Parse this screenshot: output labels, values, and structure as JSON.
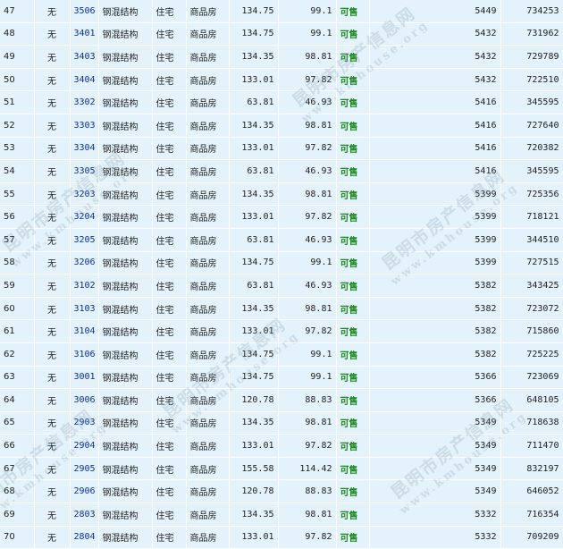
{
  "rows": [
    {
      "seq": "47",
      "wu": "无",
      "room": "3506",
      "structure": "钢混结构",
      "use": "住宅",
      "type": "商品房",
      "area": "134.75",
      "inner": "99.1",
      "status": "可售",
      "price": "5449",
      "total": "734253"
    },
    {
      "seq": "48",
      "wu": "无",
      "room": "3401",
      "structure": "钢混结构",
      "use": "住宅",
      "type": "商品房",
      "area": "134.75",
      "inner": "99.1",
      "status": "可售",
      "price": "5432",
      "total": "731962"
    },
    {
      "seq": "49",
      "wu": "无",
      "room": "3403",
      "structure": "钢混结构",
      "use": "住宅",
      "type": "商品房",
      "area": "134.35",
      "inner": "98.81",
      "status": "可售",
      "price": "5432",
      "total": "729789"
    },
    {
      "seq": "50",
      "wu": "无",
      "room": "3404",
      "structure": "钢混结构",
      "use": "住宅",
      "type": "商品房",
      "area": "133.01",
      "inner": "97.82",
      "status": "可售",
      "price": "5432",
      "total": "722510"
    },
    {
      "seq": "51",
      "wu": "无",
      "room": "3302",
      "structure": "钢混结构",
      "use": "住宅",
      "type": "商品房",
      "area": "63.81",
      "inner": "46.93",
      "status": "可售",
      "price": "5416",
      "total": "345595"
    },
    {
      "seq": "52",
      "wu": "无",
      "room": "3303",
      "structure": "钢混结构",
      "use": "住宅",
      "type": "商品房",
      "area": "134.35",
      "inner": "98.81",
      "status": "可售",
      "price": "5416",
      "total": "727640"
    },
    {
      "seq": "53",
      "wu": "无",
      "room": "3304",
      "structure": "钢混结构",
      "use": "住宅",
      "type": "商品房",
      "area": "133.01",
      "inner": "97.82",
      "status": "可售",
      "price": "5416",
      "total": "720382"
    },
    {
      "seq": "54",
      "wu": "无",
      "room": "3305",
      "structure": "钢混结构",
      "use": "住宅",
      "type": "商品房",
      "area": "63.81",
      "inner": "46.93",
      "status": "可售",
      "price": "5416",
      "total": "345595"
    },
    {
      "seq": "55",
      "wu": "无",
      "room": "3203",
      "structure": "钢混结构",
      "use": "住宅",
      "type": "商品房",
      "area": "134.35",
      "inner": "98.81",
      "status": "可售",
      "price": "5399",
      "total": "725356"
    },
    {
      "seq": "56",
      "wu": "无",
      "room": "3204",
      "structure": "钢混结构",
      "use": "住宅",
      "type": "商品房",
      "area": "133.01",
      "inner": "97.82",
      "status": "可售",
      "price": "5399",
      "total": "718121"
    },
    {
      "seq": "57",
      "wu": "无",
      "room": "3205",
      "structure": "钢混结构",
      "use": "住宅",
      "type": "商品房",
      "area": "63.81",
      "inner": "46.93",
      "status": "可售",
      "price": "5399",
      "total": "344510"
    },
    {
      "seq": "58",
      "wu": "无",
      "room": "3206",
      "structure": "钢混结构",
      "use": "住宅",
      "type": "商品房",
      "area": "134.75",
      "inner": "99.1",
      "status": "可售",
      "price": "5399",
      "total": "727515"
    },
    {
      "seq": "59",
      "wu": "无",
      "room": "3102",
      "structure": "钢混结构",
      "use": "住宅",
      "type": "商品房",
      "area": "63.81",
      "inner": "46.93",
      "status": "可售",
      "price": "5382",
      "total": "343425"
    },
    {
      "seq": "60",
      "wu": "无",
      "room": "3103",
      "structure": "钢混结构",
      "use": "住宅",
      "type": "商品房",
      "area": "134.35",
      "inner": "98.81",
      "status": "可售",
      "price": "5382",
      "total": "723072"
    },
    {
      "seq": "61",
      "wu": "无",
      "room": "3104",
      "structure": "钢混结构",
      "use": "住宅",
      "type": "商品房",
      "area": "133.01",
      "inner": "97.82",
      "status": "可售",
      "price": "5382",
      "total": "715860"
    },
    {
      "seq": "62",
      "wu": "无",
      "room": "3106",
      "structure": "钢混结构",
      "use": "住宅",
      "type": "商品房",
      "area": "134.75",
      "inner": "99.1",
      "status": "可售",
      "price": "5382",
      "total": "725225"
    },
    {
      "seq": "63",
      "wu": "无",
      "room": "3001",
      "structure": "钢混结构",
      "use": "住宅",
      "type": "商品房",
      "area": "134.75",
      "inner": "99.1",
      "status": "可售",
      "price": "5366",
      "total": "723069"
    },
    {
      "seq": "64",
      "wu": "无",
      "room": "3006",
      "structure": "钢混结构",
      "use": "住宅",
      "type": "商品房",
      "area": "120.78",
      "inner": "88.83",
      "status": "可售",
      "price": "5366",
      "total": "648105"
    },
    {
      "seq": "65",
      "wu": "无",
      "room": "2903",
      "structure": "钢混结构",
      "use": "住宅",
      "type": "商品房",
      "area": "134.35",
      "inner": "98.81",
      "status": "可售",
      "price": "5349",
      "total": "718638"
    },
    {
      "seq": "66",
      "wu": "无",
      "room": "2904",
      "structure": "钢混结构",
      "use": "住宅",
      "type": "商品房",
      "area": "133.01",
      "inner": "97.82",
      "status": "可售",
      "price": "5349",
      "total": "711470"
    },
    {
      "seq": "67",
      "wu": "无",
      "room": "2905",
      "structure": "钢混结构",
      "use": "住宅",
      "type": "商品房",
      "area": "155.58",
      "inner": "114.42",
      "status": "可售",
      "price": "5349",
      "total": "832197"
    },
    {
      "seq": "68",
      "wu": "无",
      "room": "2906",
      "structure": "钢混结构",
      "use": "住宅",
      "type": "商品房",
      "area": "120.78",
      "inner": "88.83",
      "status": "可售",
      "price": "5349",
      "total": "646052"
    },
    {
      "seq": "69",
      "wu": "无",
      "room": "2803",
      "structure": "钢混结构",
      "use": "住宅",
      "type": "商品房",
      "area": "134.35",
      "inner": "98.81",
      "status": "可售",
      "price": "5332",
      "total": "716354"
    },
    {
      "seq": "70",
      "wu": "无",
      "room": "2804",
      "structure": "钢混结构",
      "use": "住宅",
      "type": "商品房",
      "area": "133.01",
      "inner": "97.82",
      "status": "可售",
      "price": "5332",
      "total": "709209"
    }
  ],
  "watermark": {
    "cn": "昆明市房产信息网",
    "en": "www.kmhouse.org"
  }
}
